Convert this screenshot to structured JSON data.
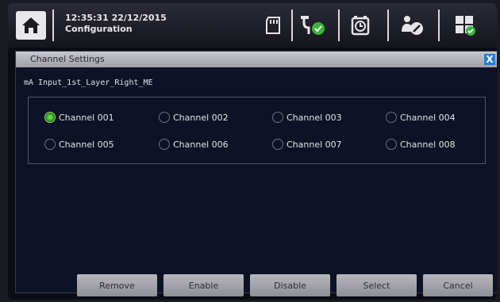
{
  "header": {
    "time": "12:35:31",
    "date": "22/12/2015",
    "mode": "Configuration",
    "icons": [
      "home-icon",
      "sd-card-icon",
      "plug-connected-icon",
      "alarm-clock-icon",
      "user-tool-icon",
      "menu-grid-icon"
    ]
  },
  "dialog": {
    "title": "Channel Settings",
    "close_label": "X",
    "input_name": "mA Input_1st_Layer_Right_ME",
    "selected_channel": "Channel 001",
    "channels": [
      {
        "label": "Channel 001",
        "selected": true
      },
      {
        "label": "Channel 002",
        "selected": false
      },
      {
        "label": "Channel 003",
        "selected": false
      },
      {
        "label": "Channel 004",
        "selected": false
      },
      {
        "label": "Channel 005",
        "selected": false
      },
      {
        "label": "Channel 006",
        "selected": false
      },
      {
        "label": "Channel 007",
        "selected": false
      },
      {
        "label": "Channel 008",
        "selected": false
      }
    ],
    "buttons": {
      "remove": "Remove",
      "enable": "Enable",
      "disable": "Disable",
      "select": "Select",
      "cancel": "Cancel"
    }
  },
  "colors": {
    "accent_blue": "#1f7fd8",
    "radio_selected": "#3dba2a",
    "status_green": "#3cb43c"
  }
}
